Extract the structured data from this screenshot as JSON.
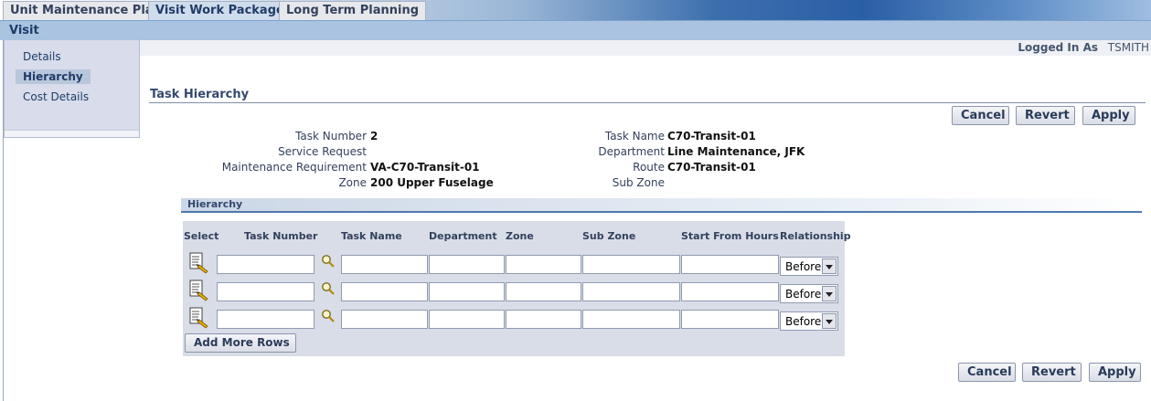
{
  "tabs": [
    {
      "label": "Unit Maintenance Plan",
      "active": false
    },
    {
      "label": "Visit Work Package",
      "active": true
    },
    {
      "label": "Long Term Planning",
      "active": false
    }
  ],
  "subnav": {
    "title": "Visit"
  },
  "sidebar": {
    "items": [
      {
        "label": "Details",
        "active": false
      },
      {
        "label": "Hierarchy",
        "active": true
      },
      {
        "label": "Cost Details",
        "active": false
      }
    ]
  },
  "header": {
    "logged_in_label": "Logged In As",
    "user": "TSMITH"
  },
  "page": {
    "title": "Task Hierarchy"
  },
  "buttons": {
    "cancel": "Cancel",
    "revert": "Revert",
    "apply": "Apply",
    "add_rows": "Add More Rows"
  },
  "task": {
    "task_number_label": "Task Number",
    "task_number": "2",
    "service_request_label": "Service Request",
    "service_request": "",
    "maintenance_requirement_label": "Maintenance Requirement",
    "maintenance_requirement": "VA-C70-Transit-01",
    "zone_label": "Zone",
    "zone": "200 Upper Fuselage",
    "task_name_label": "Task Name",
    "task_name": "C70-Transit-01",
    "department_label": "Department",
    "department": "Line Maintenance, JFK",
    "route_label": "Route",
    "route": "C70-Transit-01",
    "sub_zone_label": "Sub Zone",
    "sub_zone": ""
  },
  "hierarchy": {
    "title": "Hierarchy",
    "columns": [
      "Select",
      "Task Number",
      "Task Name",
      "Department",
      "Zone",
      "Sub Zone",
      "Start From Hours",
      "Relationship"
    ],
    "rows": [
      {
        "relationship": "Before"
      },
      {
        "relationship": "Before"
      },
      {
        "relationship": "Before"
      }
    ]
  },
  "colors": {
    "accent": "#1f3c68",
    "tab_bar": "#a9c3e1",
    "table_bg": "#d9dde8"
  }
}
